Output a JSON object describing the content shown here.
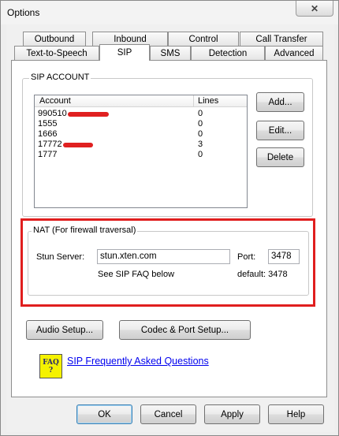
{
  "window": {
    "title": "Options",
    "close_glyph": "✕"
  },
  "tabs_row1": [
    {
      "label": "Outbound"
    },
    {
      "label": "Inbound"
    },
    {
      "label": "Control"
    },
    {
      "label": "Call Transfer"
    }
  ],
  "tabs_row2": [
    {
      "label": "Text-to-Speech"
    },
    {
      "label": "SIP",
      "active": true
    },
    {
      "label": "SMS"
    },
    {
      "label": "Detection"
    },
    {
      "label": "Advanced"
    }
  ],
  "sip_account": {
    "group_label": "SIP ACCOUNT",
    "columns": [
      "Account",
      "Lines"
    ],
    "rows": [
      {
        "account": "990510",
        "lines": "0",
        "redacted": true
      },
      {
        "account": "1555",
        "lines": "0",
        "redacted": false
      },
      {
        "account": "1666",
        "lines": "0",
        "redacted": false
      },
      {
        "account": "17772",
        "lines": "3",
        "redacted": true
      },
      {
        "account": "1777",
        "lines": "0",
        "redacted": false
      }
    ],
    "add_label": "Add...",
    "edit_label": "Edit...",
    "delete_label": "Delete"
  },
  "nat": {
    "group_label": "NAT (For firewall traversal)",
    "stun_label": "Stun Server:",
    "stun_value": "stun.xten.com",
    "port_label": "Port:",
    "port_value": "3478",
    "faq_hint": "See SIP FAQ below",
    "default_hint": "default: 3478"
  },
  "setup": {
    "audio_label": "Audio Setup...",
    "codec_label": "Codec & Port Setup..."
  },
  "faq": {
    "icon_line1": "FAQ",
    "icon_line2": "?",
    "link_text": "SIP Frequently Asked Questions"
  },
  "footer": {
    "ok_label": "OK",
    "cancel_label": "Cancel",
    "apply_label": "Apply",
    "help_label": "Help"
  },
  "colors": {
    "highlight_border": "#e01e1e",
    "link": "#0000ee",
    "redaction": "#e02020"
  }
}
